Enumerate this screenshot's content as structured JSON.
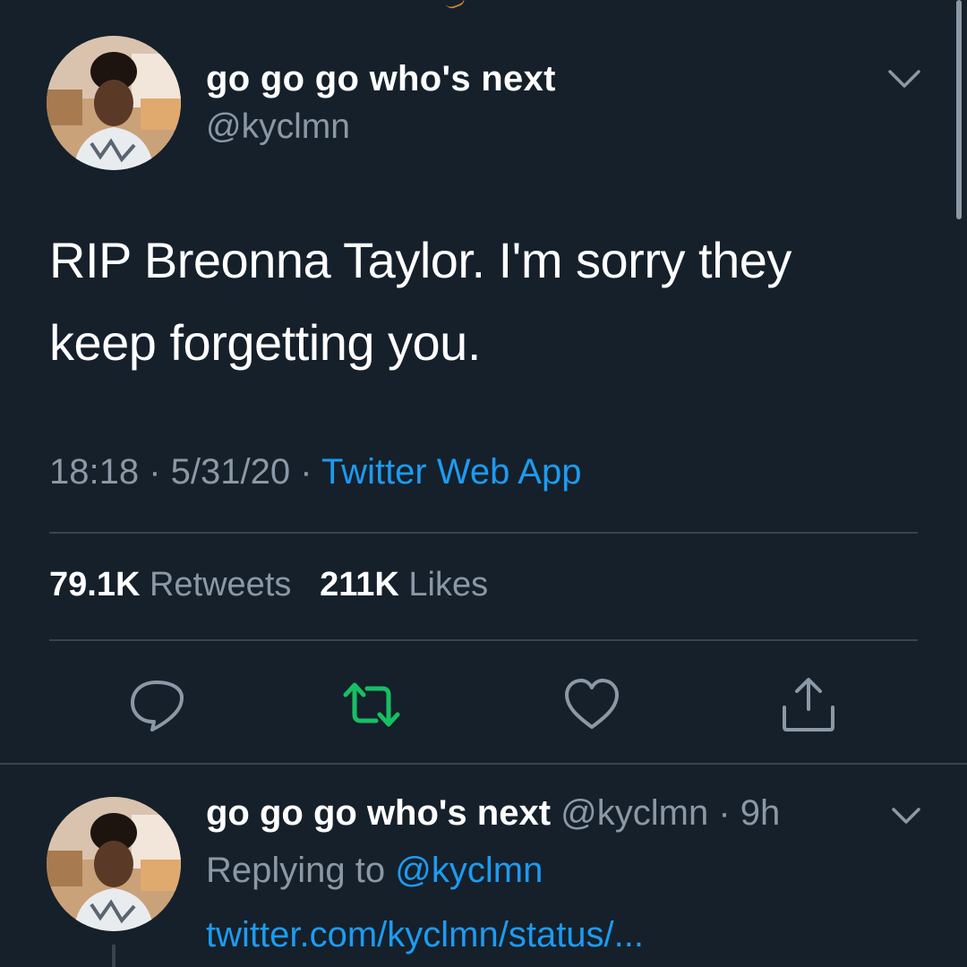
{
  "tweet": {
    "display_name": "go go go who's next",
    "handle": "@kyclmn",
    "text": "RIP Breonna Taylor. I'm sorry they keep forgetting you.",
    "time": "18:18",
    "date": "5/31/20",
    "source": "Twitter Web App",
    "separator": " · ",
    "retweets_count": "79.1K",
    "retweets_label": "Retweets",
    "likes_count": "211K",
    "likes_label": "Likes"
  },
  "reply": {
    "display_name": "go go go who's next",
    "handle": "@kyclmn",
    "age": "9h",
    "separator": " · ",
    "replying_prefix": "Replying to",
    "replying_to": "@kyclmn",
    "link": "twitter.com/kyclmn/status/..."
  },
  "icons": {
    "reply": "reply-icon",
    "retweet": "retweet-icon",
    "like": "heart-icon",
    "share": "share-icon",
    "menu": "chevron-down-icon"
  },
  "colors": {
    "background": "#15202b",
    "accent": "#1d9bf0",
    "retweet_active": "#17bf63",
    "secondary_text": "#8b98a5",
    "divider": "#38444d"
  }
}
